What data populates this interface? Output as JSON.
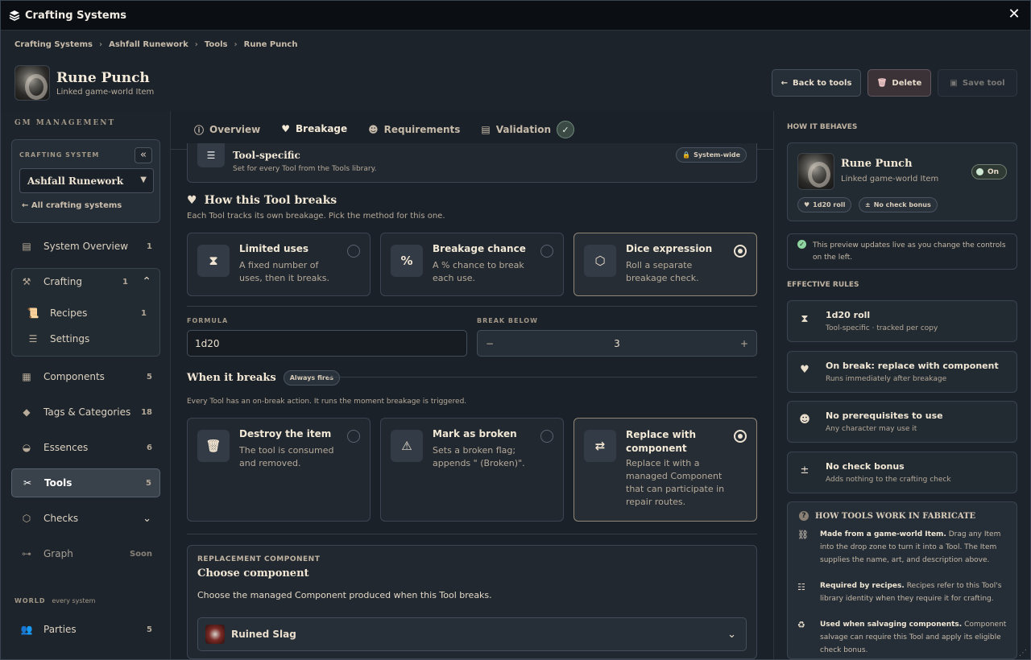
{
  "window": {
    "title": "Crafting Systems"
  },
  "breadcrumb": [
    "Crafting Systems",
    "Ashfall Runework",
    "Tools",
    "Rune Punch"
  ],
  "header": {
    "name": "Rune Punch",
    "subtitle": "Linked game-world Item",
    "back_label": "Back to tools",
    "delete_label": "Delete",
    "save_label": "Save tool"
  },
  "sidebar": {
    "section": "GM MANAGEMENT",
    "crafting_system_label": "CRAFTING SYSTEM",
    "crafting_system_value": "Ashfall Runework",
    "all_systems": "All crafting systems",
    "items": [
      {
        "label": "System Overview",
        "count": "1"
      },
      {
        "label": "Crafting",
        "count": "1"
      },
      {
        "label": "Recipes",
        "count": "1"
      },
      {
        "label": "Settings",
        "count": ""
      },
      {
        "label": "Components",
        "count": "5"
      },
      {
        "label": "Tags & Categories",
        "count": "18"
      },
      {
        "label": "Essences",
        "count": "6"
      },
      {
        "label": "Tools",
        "count": "5"
      },
      {
        "label": "Checks",
        "count": ""
      },
      {
        "label": "Graph",
        "count": "Soon"
      }
    ],
    "world_label": "WORLD",
    "world_sub": "every system",
    "parties": {
      "label": "Parties",
      "count": "5"
    }
  },
  "tabs": [
    "Overview",
    "Breakage",
    "Requirements",
    "Validation"
  ],
  "scope": {
    "title": "Tool-specific",
    "desc": "Set for every Tool from the Tools library.",
    "badge": "System-wide"
  },
  "breaks": {
    "title": "How this Tool breaks",
    "desc": "Each Tool tracks its own breakage. Pick the method for this one.",
    "options": [
      {
        "title": "Limited uses",
        "desc": "A fixed number of uses, then it breaks.",
        "selected": false
      },
      {
        "title": "Breakage chance",
        "desc": "A % chance to break each use.",
        "selected": false
      },
      {
        "title": "Dice expression",
        "desc": "Roll a separate breakage check.",
        "selected": true
      }
    ],
    "formula_label": "FORMULA",
    "formula_value": "1d20",
    "below_label": "BREAK BELOW",
    "below_value": "3"
  },
  "on_break": {
    "title": "When it breaks",
    "badge": "Always fires",
    "desc": "Every Tool has an on-break action. It runs the moment breakage is triggered.",
    "options": [
      {
        "title": "Destroy the item",
        "desc": "The tool is consumed and removed.",
        "selected": false
      },
      {
        "title": "Mark as broken",
        "desc": "Sets a broken flag; appends \" (Broken)\".",
        "selected": false
      },
      {
        "title": "Replace with component",
        "desc": "Replace it with a managed Component that can participate in repair routes.",
        "selected": true
      }
    ]
  },
  "replacement": {
    "label": "REPLACEMENT COMPONENT",
    "title": "Choose component",
    "desc": "Choose the managed Component produced when this Tool breaks.",
    "value": "Ruined Slag"
  },
  "right": {
    "behaves_label": "HOW IT BEHAVES",
    "preview_name": "Rune Punch",
    "preview_sub": "Linked game-world Item",
    "toggle": "On",
    "chips": [
      "1d20 roll",
      "No check bonus"
    ],
    "note": "This preview updates live as you change the controls on the left.",
    "rules_label": "EFFECTIVE RULES",
    "rules": [
      {
        "a": "1d20 roll",
        "b": "Tool-specific · tracked per copy"
      },
      {
        "a": "On break: replace with component",
        "b": "Runs immediately after breakage"
      },
      {
        "a": "No prerequisites to use",
        "b": "Any character may use it"
      },
      {
        "a": "No check bonus",
        "b": "Adds nothing to the crafting check"
      }
    ],
    "howto_title": "HOW TOOLS WORK IN FABRICATE",
    "howto": [
      {
        "bold": "Made from a game-world Item.",
        "text": "Drag any Item into the drop zone to turn it into a Tool. The Item supplies the name, art, and description above."
      },
      {
        "bold": "Required by recipes.",
        "text": "Recipes refer to this Tool's library identity when they require it for crafting."
      },
      {
        "bold": "Used when salvaging components.",
        "text": "Component salvage can require this Tool and apply its eligible check bonus."
      }
    ]
  }
}
